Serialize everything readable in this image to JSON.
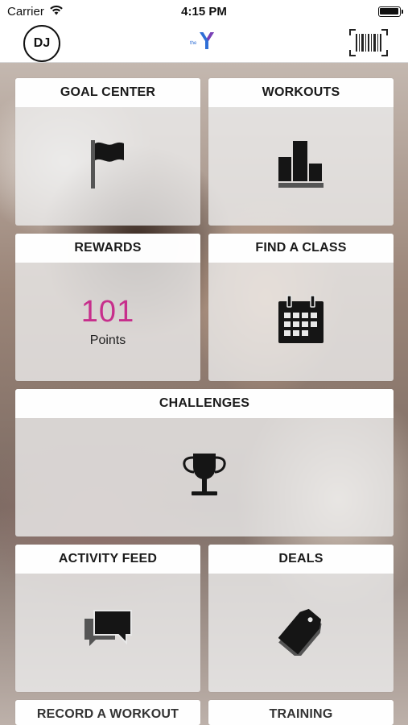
{
  "status_bar": {
    "carrier": "Carrier",
    "time": "4:15 PM"
  },
  "nav": {
    "avatar_initials": "DJ",
    "logo_icon": "ymca-logo-icon",
    "barcode_icon": "barcode-icon"
  },
  "tiles": {
    "goal_center": {
      "title": "GOAL CENTER",
      "icon": "flag-icon"
    },
    "workouts": {
      "title": "WORKOUTS",
      "icon": "bar-chart-icon"
    },
    "rewards": {
      "title": "REWARDS",
      "points_value": "101",
      "points_label": "Points"
    },
    "find_a_class": {
      "title": "FIND A CLASS",
      "icon": "calendar-icon"
    },
    "challenges": {
      "title": "CHALLENGES",
      "icon": "trophy-icon"
    },
    "activity_feed": {
      "title": "ACTIVITY FEED",
      "icon": "chat-bubbles-icon"
    },
    "deals": {
      "title": "DEALS",
      "icon": "tag-icon"
    },
    "record_a_workout": {
      "title": "RECORD A WORKOUT"
    },
    "training": {
      "title": "TRAINING"
    }
  },
  "colors": {
    "accent_points": "#c72f8c",
    "logo_blue": "#2f6fd6",
    "logo_purple": "#7b3fb5"
  }
}
